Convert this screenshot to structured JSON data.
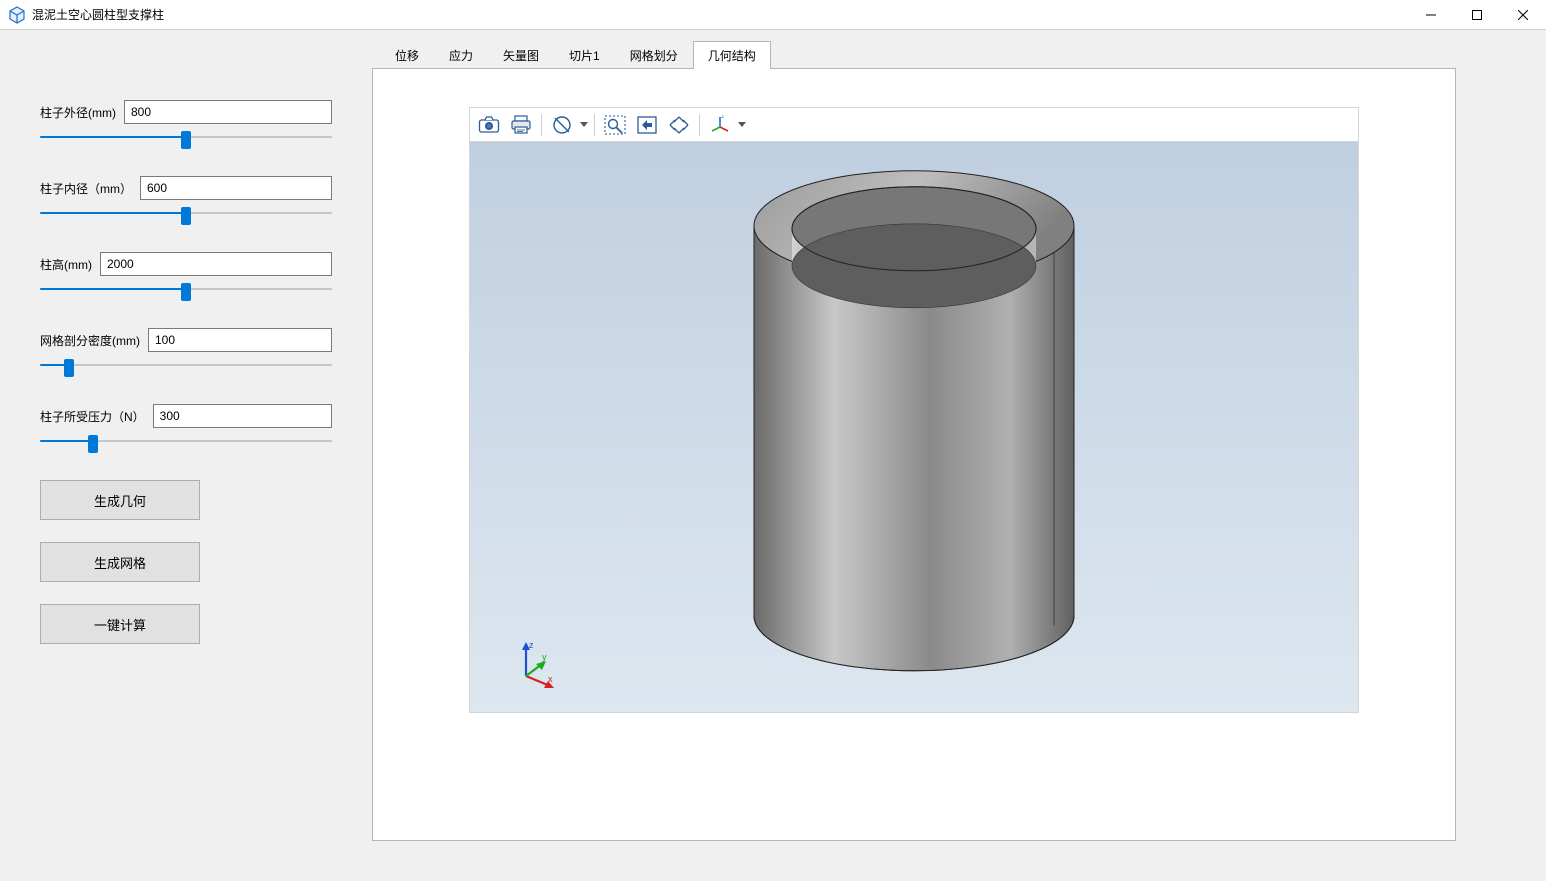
{
  "window": {
    "title": "混泥土空心圆柱型支撑柱"
  },
  "params": {
    "outer_d": {
      "label": "柱子外径(mm)",
      "value": "800",
      "slider_pct": 50
    },
    "inner_d": {
      "label": "柱子内径（mm）",
      "value": "600",
      "slider_pct": 50
    },
    "height": {
      "label": "柱高(mm)",
      "value": "2000",
      "slider_pct": 50
    },
    "mesh": {
      "label": "网格剖分密度(mm)",
      "value": "100",
      "slider_pct": 10
    },
    "force": {
      "label": "柱子所受压力（N）",
      "value": "300",
      "slider_pct": 18
    }
  },
  "buttons": {
    "gen_geom": "生成几何",
    "gen_mesh": "生成网格",
    "compute": "一键计算"
  },
  "tabs": {
    "items": [
      "位移",
      "应力",
      "矢量图",
      "切片1",
      "网格划分",
      "几何结构"
    ],
    "active_index": 5
  },
  "toolbar_icons": {
    "camera": "camera-icon",
    "print": "print-icon",
    "lock": "lock-icon",
    "zoom_window": "zoom-window-icon",
    "fit": "fit-view-icon",
    "expand": "zoom-extents-icon",
    "axes": "axes-view-icon"
  },
  "gizmo": {
    "x": "x",
    "y": "y",
    "z": "z"
  }
}
